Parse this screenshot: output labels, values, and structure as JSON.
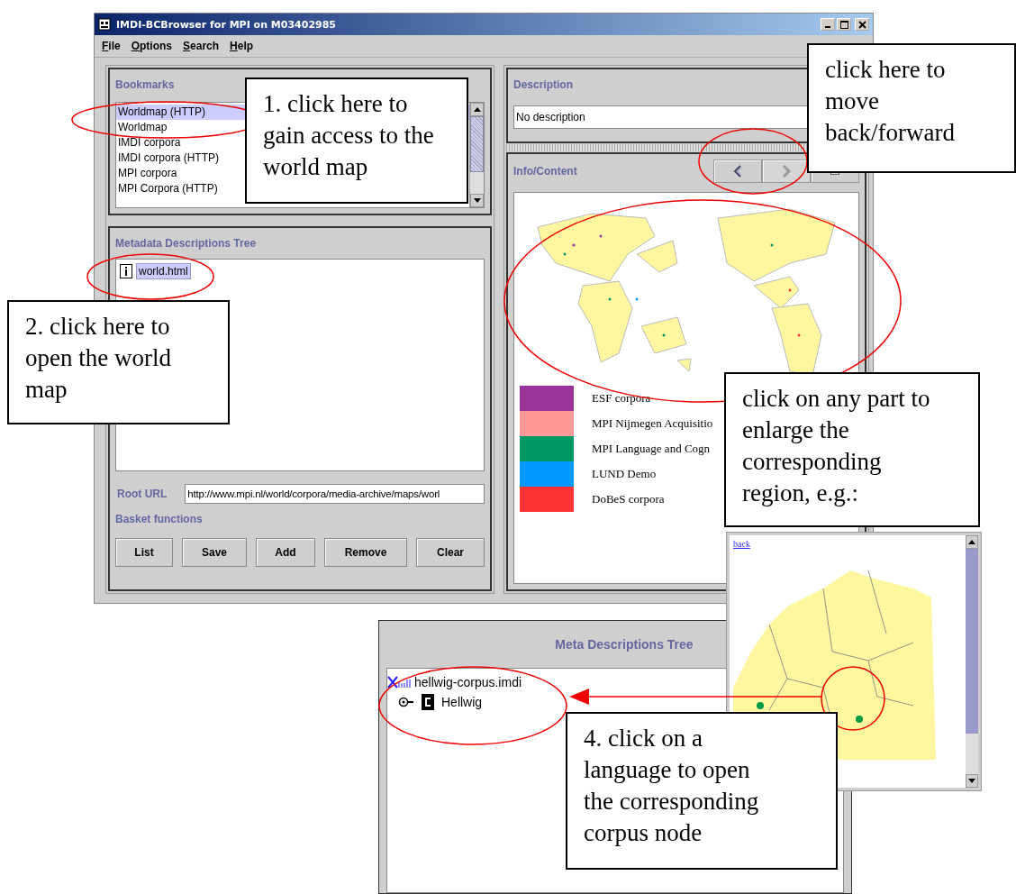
{
  "main_window": {
    "title": "IMDI-BCBrowser for MPI on M03402985",
    "menu": [
      "File",
      "Options",
      "Search",
      "Help"
    ],
    "bookmarks": {
      "heading": "Bookmarks",
      "items": [
        {
          "label": "Worldmap (HTTP)",
          "selected": true
        },
        {
          "label": "Worldmap",
          "selected": false
        },
        {
          "label": "IMDI corpora",
          "selected": false
        },
        {
          "label": "IMDI corpora (HTTP)",
          "selected": false
        },
        {
          "label": "MPI corpora",
          "selected": false
        },
        {
          "label": "MPI Corpora (HTTP)",
          "selected": false
        }
      ]
    },
    "tree": {
      "heading": "Metadata Descriptions Tree",
      "nodes": [
        {
          "label": "world.html",
          "selected": true
        }
      ]
    },
    "root_url": {
      "label": "Root URL",
      "value": "http://www.mpi.nl/world/corpora/media-archive/maps/worl"
    },
    "basket": {
      "heading": "Basket functions",
      "buttons": [
        "List",
        "Save",
        "Add",
        "Remove",
        "Clear"
      ]
    },
    "description": {
      "heading": "Description",
      "value": "No description"
    },
    "info": {
      "heading": "Info/Content",
      "nav": [
        {
          "kind": "back",
          "disabled": false
        },
        {
          "kind": "forward",
          "disabled": true
        }
      ],
      "legend": [
        {
          "label": "ESF corpora",
          "color": "#993399"
        },
        {
          "label": "MPI Nijmegen Acquisitio",
          "color": "#ff9999"
        },
        {
          "label": "MPI Language and Cogn",
          "color": "#009966"
        },
        {
          "label": "LUND Demo",
          "color": "#0099ff"
        },
        {
          "label": "DoBeS corpora",
          "color": "#ff3333"
        }
      ]
    }
  },
  "tree_window": {
    "heading": "Meta Descriptions Tree",
    "nodes": [
      {
        "label": "hellwig-corpus.imdi",
        "kind": "file",
        "children": [
          {
            "label": "Hellwig",
            "kind": "corpus"
          }
        ]
      }
    ]
  },
  "map_window": {
    "link": "back"
  },
  "callouts": [
    {
      "text": "1. click here to gain access to the world map"
    },
    {
      "text": "2. click here to open the world map"
    },
    {
      "text": "click here to move back/forward"
    },
    {
      "text": "click on any part to enlarge the corresponding region, e.g.:"
    },
    {
      "text": "4. click on a language to open the corresponding corpus node"
    }
  ]
}
